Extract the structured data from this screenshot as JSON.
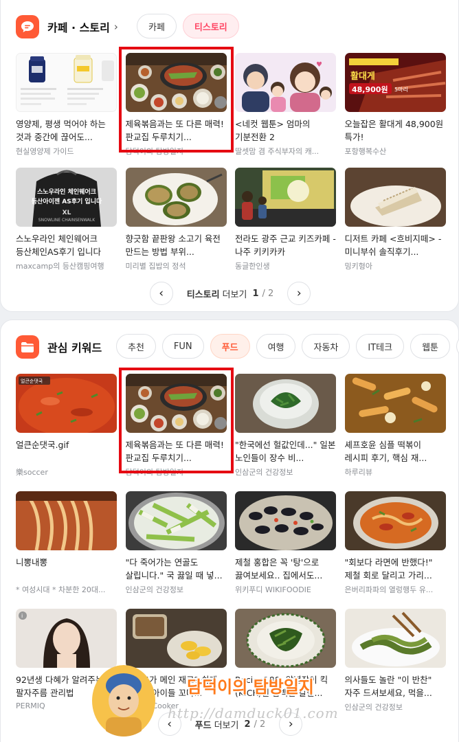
{
  "section1": {
    "title": "카페 · 스토리",
    "chevron": "›",
    "tabs": [
      {
        "label": "카페",
        "active": false
      },
      {
        "label": "티스토리",
        "active": true
      }
    ],
    "items": [
      {
        "title": "영양제, 평생 먹어야 하는 것과 중간에 끊어도...",
        "source": "현실영양제 가이드",
        "thumb": "supplements",
        "highlight": false
      },
      {
        "title": "제육볶음과는 또 다른 매력! 판교집 두루치기...",
        "source": "담덕이의 탐방일지",
        "thumb": "table-food",
        "highlight": true
      },
      {
        "title": "<네컷 웹툰> 엄마의 기분전환 2",
        "source": "딸셋맘 겸 주식부자의 캐...",
        "thumb": "webtoon",
        "highlight": false
      },
      {
        "title": "오늘잡은 활대게 48,900원 특가!",
        "source": "포항행복수산",
        "thumb": "crab",
        "highlight": false
      },
      {
        "title": "스노우라인 체인웨어크 등산체인AS후기 입니다",
        "source": "maxcamp의 등산캠핑여행",
        "thumb": "chain-bag",
        "highlight": false
      },
      {
        "title": "향긋함 끝판왕 소고기 육전 만드는 방법 부위...",
        "source": "미리별 집밥의 정석",
        "thumb": "jeon",
        "highlight": false
      },
      {
        "title": "전라도 광주 근교 키즈카페 - 나주 키키카카",
        "source": "동글한인생",
        "thumb": "kids",
        "highlight": false
      },
      {
        "title": "디저트 카페 <흐비지떼> - 미니부쉬 솔직후기...",
        "source": "밍키형아",
        "thumb": "cake",
        "highlight": false
      }
    ],
    "thumb_overlay": {
      "chain_line1": "스노우라인 체인웨어크",
      "chain_line2": "등산아이젠 AS후기 입니다",
      "chain_tag": "XL",
      "chain_brand": "SNOWLINE CHAINSENWALK",
      "crab_tag": "활대게",
      "crab_price": "48,900원",
      "crab_unit": "5마리"
    },
    "pager": {
      "prev": "‹",
      "next": "›",
      "label_bold": "티스토리",
      "label": "더보기",
      "current": "1",
      "total": "/ 2"
    }
  },
  "section2": {
    "title": "관심 키워드",
    "tabs": [
      {
        "label": "추천",
        "active": false
      },
      {
        "label": "FUN",
        "active": false
      },
      {
        "label": "푸드",
        "active": true
      },
      {
        "label": "여행",
        "active": false
      },
      {
        "label": "자동차",
        "active": false
      },
      {
        "label": "IT테크",
        "active": false
      },
      {
        "label": "웹툰",
        "active": false
      }
    ],
    "tabs_next": "›",
    "items": [
      {
        "title": "얼큰순댓국.gif",
        "source": "樂soccer",
        "thumb": "soup",
        "highlight": false
      },
      {
        "title": "제육볶음과는 또 다른 매력! 판교집 두루치기...",
        "source": "담덕이의 탐방일지",
        "thumb": "table-food",
        "highlight": true
      },
      {
        "title": "\"한국에선 헐값인데...\" 일본 노인들이 장수 비...",
        "source": "인삼군의 건강정보",
        "thumb": "greens-bowl",
        "highlight": false
      },
      {
        "title": "셰프호윤 심플 떡볶이 레시피 후기, 핵심 재...",
        "source": "하루리뷰",
        "thumb": "tteokbokki",
        "highlight": false
      },
      {
        "title": "니뽕내뽕",
        "source": "* 여성시대 * 차분한 20대...",
        "thumb": "noodles",
        "highlight": false
      },
      {
        "title": "\"다 죽어가는 연골도 살립니다.\" 국 끓일 때 넣...",
        "source": "인삼군의 건강정보",
        "thumb": "green-onion",
        "highlight": false
      },
      {
        "title": "제철 홍합은 꼭 '탕'으로 끓여보세요.. 집에서도...",
        "source": "위키푸디 WIKIFOODIE",
        "thumb": "mussels",
        "highlight": false
      },
      {
        "title": "\"회보다 라면에 반했다!\" 제철 회로 달리고 가리...",
        "source": "은버리파파의 열렁행두 유...",
        "thumb": "ramen",
        "highlight": false
      },
      {
        "title": "92년생 다혜가 알려주는 팔자주름 관리법",
        "source": "PERMIQ",
        "thumb": "woman",
        "highlight": false
      },
      {
        "title": "양배추가 메인 재료? 쉽게 만드는 아이들 꼬마...",
        "source": "Happy Cooker",
        "thumb": "pickles",
        "highlight": false
      },
      {
        "title": "Recipe188. 양념장이 킥(KICK)인 담백한 갈칠...",
        "source": "",
        "thumb": "greens-plate",
        "highlight": false
      },
      {
        "title": "의사들도 놀란 \"이 반찬\" 자주 드셔보세요, 먹을...",
        "source": "인삼군의 건강정보",
        "thumb": "seaweed",
        "highlight": false
      }
    ],
    "thumb_overlay": {
      "soup_tag": "얼큰순댓국"
    },
    "pager": {
      "prev": "‹",
      "next": "›",
      "label_bold": "푸드",
      "label": "더보기",
      "current": "2",
      "total": "/ 2"
    }
  },
  "watermark": {
    "title": "담덕이의 탐방일지",
    "url": "http://damduck01.com"
  },
  "colors": {
    "accent": "#ff5a36",
    "highlight_border": "#e50912",
    "pink_tab": "#ff4462"
  }
}
